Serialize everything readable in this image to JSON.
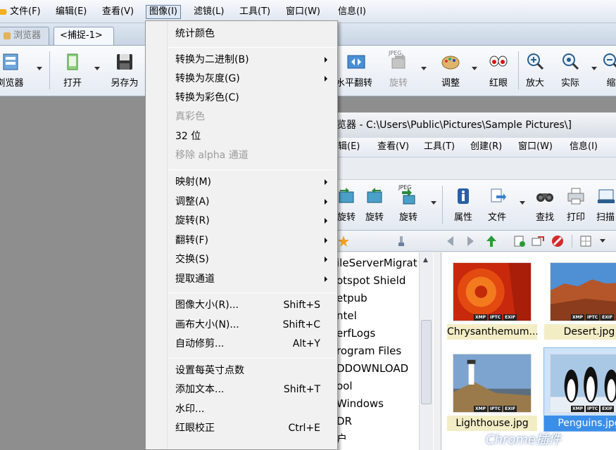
{
  "menubar": {
    "items": [
      "文件(F)",
      "编辑(E)",
      "查看(V)",
      "图像(I)",
      "滤镜(L)",
      "工具(T)",
      "窗口(W)",
      "信息(I)"
    ]
  },
  "tabs": [
    "浏览器",
    "<捕捉-1>"
  ],
  "toolbar": {
    "buttons": [
      "浏览器",
      "打开",
      "另存为",
      "水平翻转",
      "旋转",
      "调整",
      "红眼",
      "放大",
      "实际",
      "缩"
    ],
    "jpeg_label": "JPEG"
  },
  "image_menu": {
    "items": [
      {
        "label": "统计颜色"
      },
      {
        "label": "转换为二进制(B)",
        "submenu": true
      },
      {
        "label": "转换为灰度(G)",
        "submenu": true
      },
      {
        "label": "转换为彩色(C)"
      },
      {
        "label": "真彩色",
        "disabled": true
      },
      {
        "label": "32 位"
      },
      {
        "label": "移除 alpha 通道",
        "disabled": true
      },
      {
        "label": "映射(M)",
        "submenu": true
      },
      {
        "label": "调整(A)",
        "submenu": true
      },
      {
        "label": "旋转(R)",
        "submenu": true
      },
      {
        "label": "翻转(F)",
        "submenu": true
      },
      {
        "label": "交换(S)",
        "submenu": true
      },
      {
        "label": "提取通道",
        "submenu": true
      },
      {
        "label": "图像大小(R)...",
        "shortcut": "Shift+S"
      },
      {
        "label": "画布大小(N)...",
        "shortcut": "Shift+C"
      },
      {
        "label": "自动修剪...",
        "shortcut": "Alt+Y"
      },
      {
        "label": "设置每英寸点数"
      },
      {
        "label": "添加文本...",
        "shortcut": "Shift+T"
      },
      {
        "label": "水印..."
      },
      {
        "label": "红眼校正",
        "shortcut": "Ctrl+E"
      }
    ]
  },
  "inner_window": {
    "title": "览器 - C:\\Users\\Public\\Pictures\\Sample Pictures\\]",
    "menubar": [
      "辑(E)",
      "查看(V)",
      "工具(T)",
      "创建(R)",
      "窗口(W)",
      "信息(I)"
    ],
    "toolbar": [
      "旋转",
      "旋转",
      "旋转",
      "属性",
      "文件",
      "查找",
      "打印",
      "扫描"
    ],
    "jpeg_label": "JPEG",
    "folders": [
      "ileServerMigrat",
      "otspot Shield",
      "etpub",
      "ntel",
      "erfLogs",
      "rogram Files",
      "DDOWNLOAD",
      "ool",
      "Windows",
      "DR",
      "户"
    ],
    "thumbnails": [
      {
        "caption": "Chrysanthemum...",
        "selected": false
      },
      {
        "caption": "Desert.jpg",
        "selected": false
      },
      {
        "caption": "Lighthouse.jpg",
        "selected": false
      },
      {
        "caption": "Penguins.jpg",
        "selected": true
      }
    ],
    "badges": [
      "XMP",
      "IPTC",
      "EXIF"
    ]
  },
  "watermark": "Chrome插件",
  "colors": {
    "menu_bg": "#f1f1f1",
    "workspace": "#8e8e8e",
    "selection": "#3b8ee8",
    "caption_bg": "#f3edc6"
  }
}
